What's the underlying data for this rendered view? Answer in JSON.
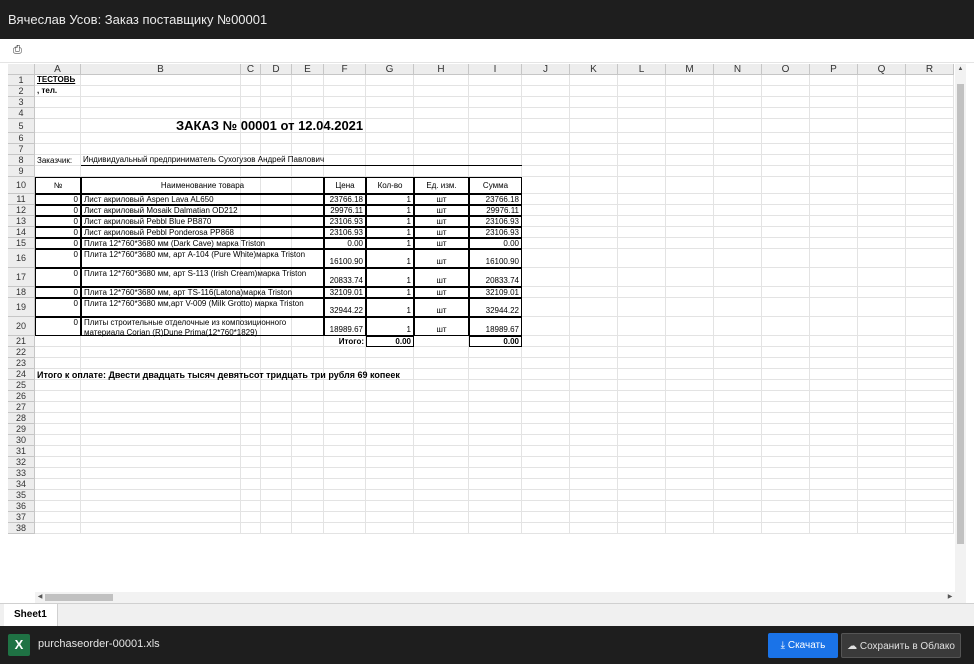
{
  "window": {
    "title": "Вячеслав Усов: Заказ поставщику №00001"
  },
  "toolbar": {
    "icon": "print-icon"
  },
  "columns": [
    "A",
    "B",
    "C",
    "D",
    "E",
    "F",
    "G",
    "H",
    "I",
    "J",
    "K",
    "L",
    "M",
    "N",
    "O",
    "P",
    "Q",
    "R"
  ],
  "rows": [
    "1",
    "2",
    "3",
    "4",
    "5",
    "6",
    "7",
    "8",
    "9",
    "10",
    "11",
    "12",
    "13",
    "14",
    "15",
    "16",
    "17",
    "18",
    "19",
    "20",
    "21",
    "22",
    "23",
    "24",
    "25",
    "26",
    "27",
    "28",
    "29",
    "30",
    "31",
    "32",
    "33",
    "34",
    "35",
    "36",
    "37",
    "38"
  ],
  "doc": {
    "company": "ТЕСТОВЬ",
    "phone": ", тел.",
    "order_title": "ЗАКАЗ № 00001 от 12.04.2021",
    "customer_label": "Заказчик:",
    "customer_value": "Индивидуальный предприниматель Сухогузов Андрей Павлович",
    "table_headers": {
      "num": "№",
      "name": "Наименование товара",
      "price": "Цена",
      "qty": "Кол-во",
      "unit": "Ед. изм.",
      "sum": "Сумма"
    },
    "items": [
      {
        "num": "0",
        "name": "Лист акриловый Aspen Lava AL650",
        "price": "23766.18",
        "qty": "1",
        "unit": "шт",
        "sum": "23766.18"
      },
      {
        "num": "0",
        "name": "Лист акриловый Mosaik Dalmatian OD212",
        "price": "29976.11",
        "qty": "1",
        "unit": "шт",
        "sum": "29976.11"
      },
      {
        "num": "0",
        "name": "Лист акриловый Pebbl Blue PB870",
        "price": "23106.93",
        "qty": "1",
        "unit": "шт",
        "sum": "23106.93"
      },
      {
        "num": "0",
        "name": "Лист акриловый Pebbl Ponderosa PP868",
        "price": "23106.93",
        "qty": "1",
        "unit": "шт",
        "sum": "23106.93"
      },
      {
        "num": "0",
        "name": "Плита 12*760*3680 мм (Dark Cave) марка Triston",
        "price": "0.00",
        "qty": "1",
        "unit": "шт",
        "sum": "0.00"
      },
      {
        "num": "0",
        "name": "Плита 12*760*3680 мм, арт A-104 (Pure White)марка Triston",
        "price": "16100.90",
        "qty": "1",
        "unit": "шт",
        "sum": "16100.90"
      },
      {
        "num": "0",
        "name": "Плита 12*760*3680 мм, арт S-113 (Irish Cream)марка Triston",
        "price": "20833.74",
        "qty": "1",
        "unit": "шт",
        "sum": "20833.74"
      },
      {
        "num": "0",
        "name": "Плита 12*760*3680 мм, арт TS-116(Latona)марка Triston",
        "price": "32109.01",
        "qty": "1",
        "unit": "шт",
        "sum": "32109.01"
      },
      {
        "num": "0",
        "name": "Плита 12*760*3680 мм,арт V-009 (Milk Grotto) марка Triston",
        "price": "32944.22",
        "qty": "1",
        "unit": "шт",
        "sum": "32944.22"
      },
      {
        "num": "0",
        "name_line1": "Плиты строительные отделочные из композиционного",
        "name_line2": "материала Corian (R)Dune Prima(12*760*1829)",
        "price": "18989.67",
        "qty": "1",
        "unit": "шт",
        "sum": "18989.67"
      }
    ],
    "total_label": "Итого:",
    "total_qty": "0.00",
    "total_sum": "0.00",
    "pay_text": "Итого к оплате: Двести двадцать тысяч девятьсот тридцать три рубля 69 копеек"
  },
  "sheet_tab": "Sheet1",
  "footer": {
    "file_icon": "excel-file-icon",
    "file_icon_letter": "X",
    "filename": "purchaseorder-00001.xls",
    "download_label": "Скачать",
    "cloud_label": "Сохранить в Облако"
  }
}
